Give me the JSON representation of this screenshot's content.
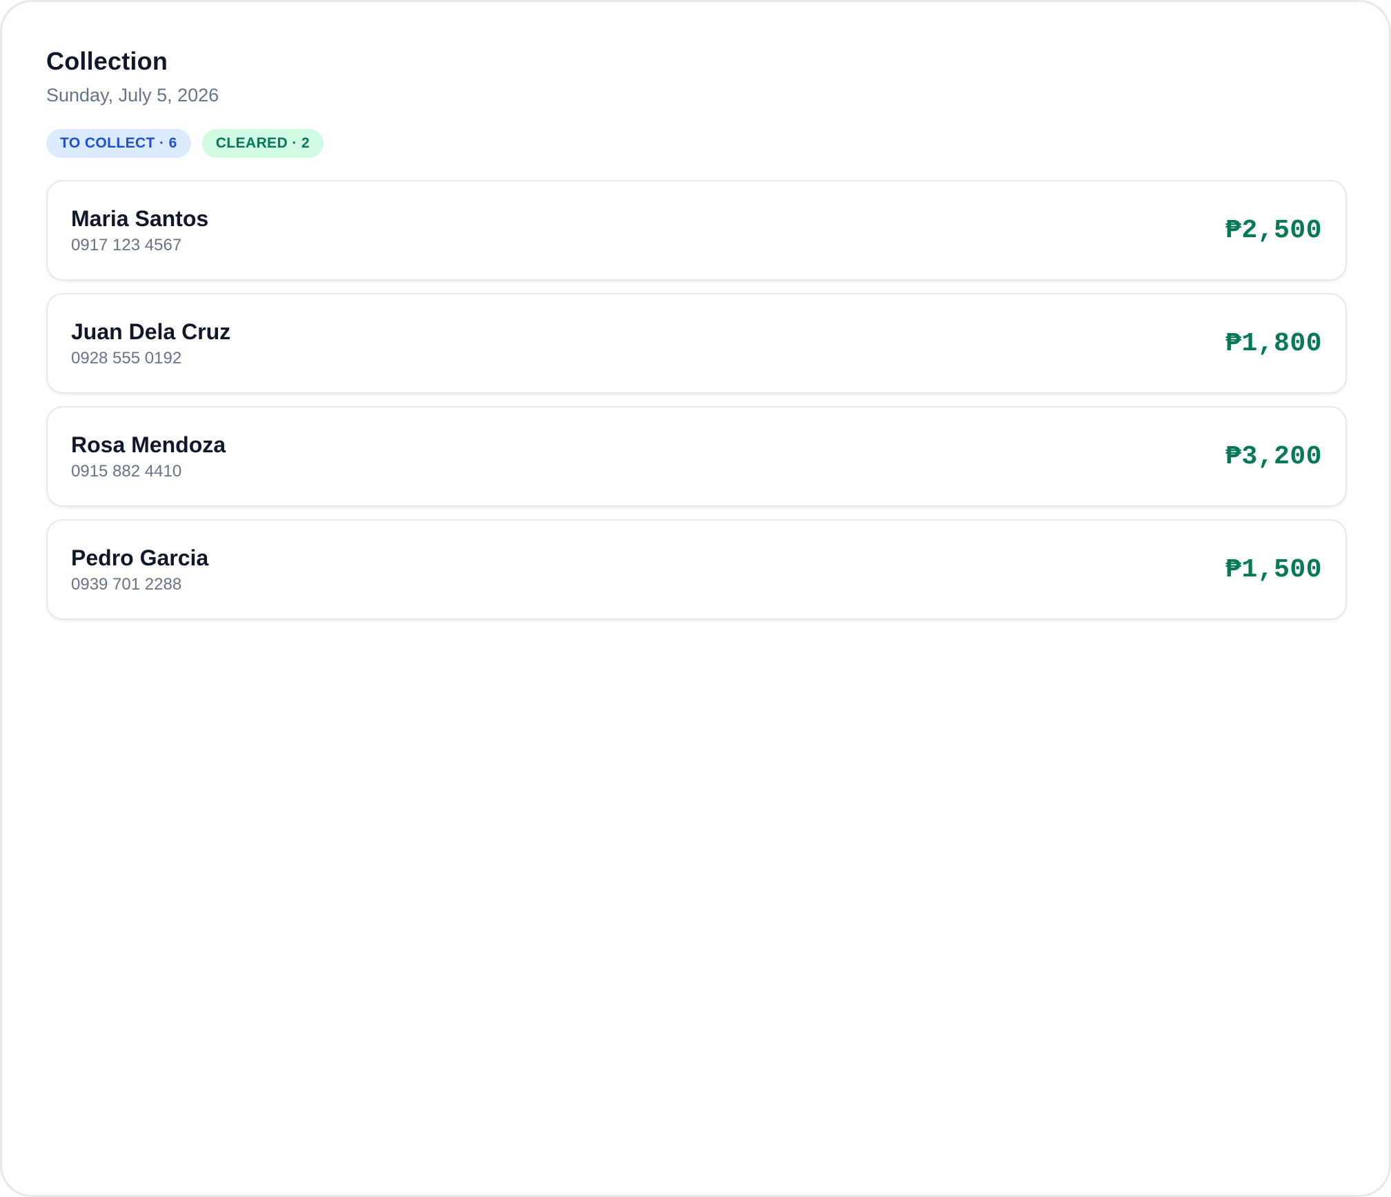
{
  "header": {
    "title": "Collection",
    "date": "Sunday, July 5, 2026"
  },
  "badges": {
    "to_collect": "TO COLLECT · 6",
    "cleared": "CLEARED · 2"
  },
  "collections": [
    {
      "name": "Maria Santos",
      "phone": "0917 123 4567",
      "amount": "₱2,500"
    },
    {
      "name": "Juan Dela Cruz",
      "phone": "0928 555 0192",
      "amount": "₱1,800"
    },
    {
      "name": "Rosa Mendoza",
      "phone": "0915 882 4410",
      "amount": "₱3,200"
    },
    {
      "name": "Pedro Garcia",
      "phone": "0939 701 2288",
      "amount": "₱1,500"
    }
  ],
  "colors": {
    "to_collect_badge_bg": "#dbeafe",
    "to_collect_badge_text": "#1d4ed8",
    "cleared_badge_bg": "#d1fae5",
    "cleared_badge_text": "#047857",
    "amount_text": "#047857"
  }
}
